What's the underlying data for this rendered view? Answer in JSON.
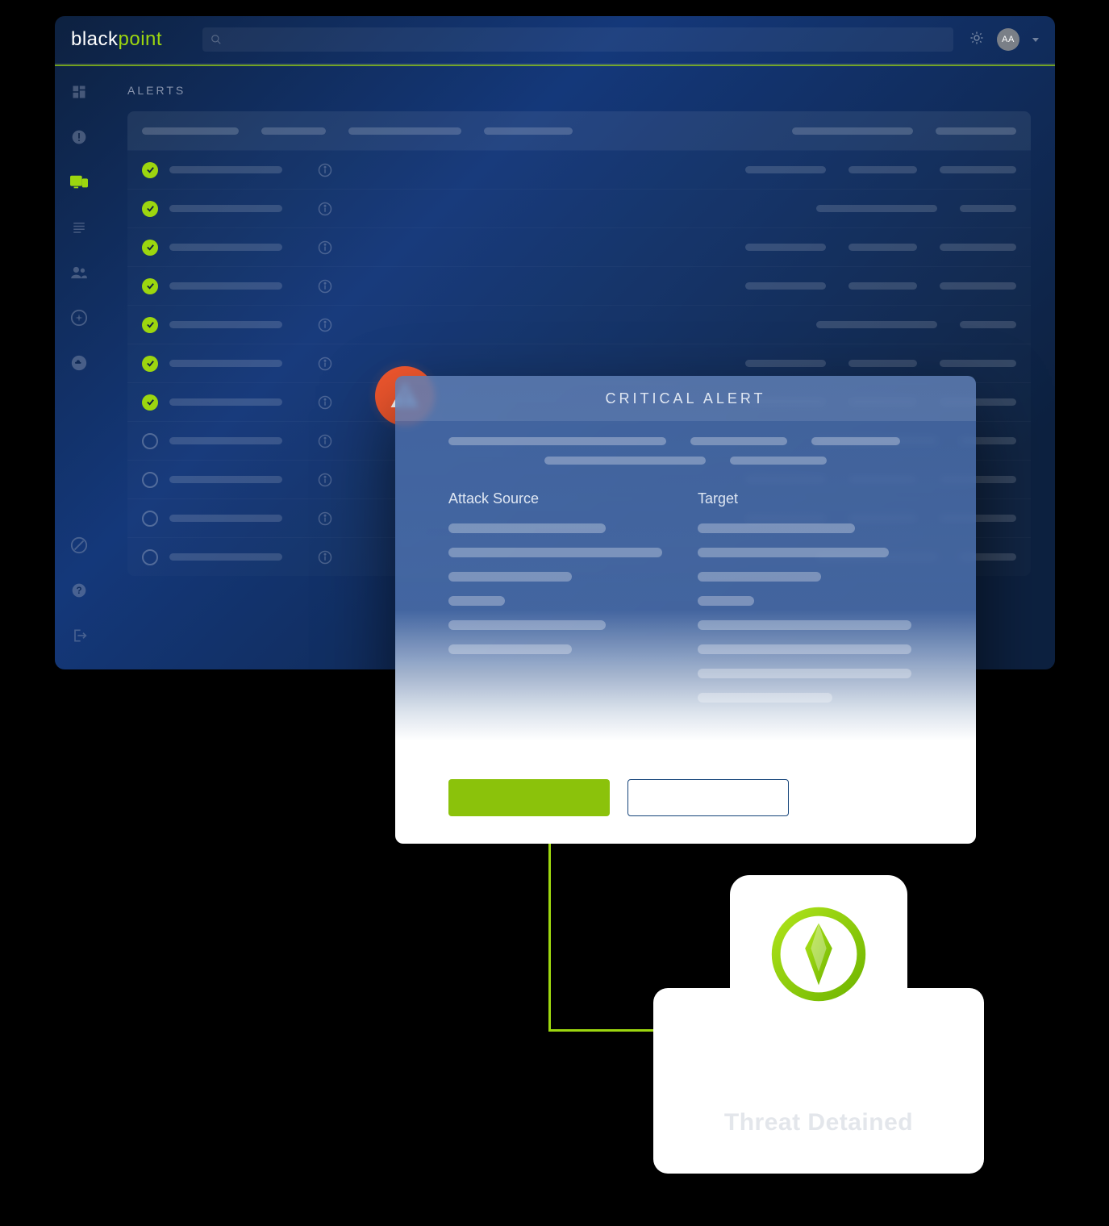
{
  "brand": {
    "part1": "black",
    "part2": "point"
  },
  "header": {
    "avatar_initials": "AA"
  },
  "page": {
    "title": "ALERTS"
  },
  "alerts_rows": [
    {
      "status": "ok"
    },
    {
      "status": "ok"
    },
    {
      "status": "ok"
    },
    {
      "status": "ok"
    },
    {
      "status": "ok"
    },
    {
      "status": "ok"
    },
    {
      "status": "ok"
    },
    {
      "status": "none"
    },
    {
      "status": "none"
    },
    {
      "status": "none"
    },
    {
      "status": "none"
    }
  ],
  "critical_alert": {
    "title": "CRITICAL ALERT",
    "col1_title": "Attack Source",
    "col2_title": "Target"
  },
  "detained": {
    "label": "Threat Detained"
  },
  "colors": {
    "accent": "#9cd60f",
    "danger": "#f1572e"
  }
}
